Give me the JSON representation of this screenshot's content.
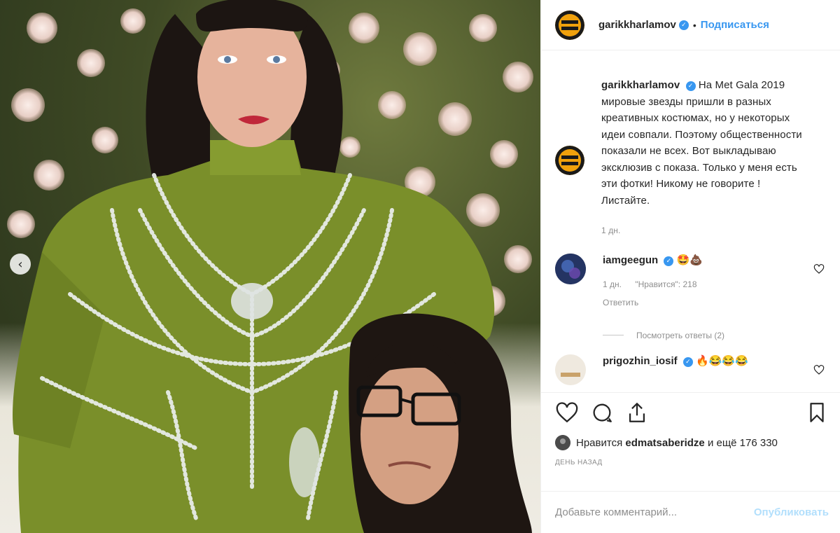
{
  "post": {
    "author": "garikkharlamov",
    "follow_label": "Подписаться",
    "separator": "•"
  },
  "caption": {
    "username": "garikkharlamov",
    "text": "На Met Gala 2019 мировые звезды пришли в разных креативных костюмах, но у некоторых идеи совпали. Поэтому общественности показали не всех. Вот выкладываю эксклюзив с показа. Только у меня есть эти фотки! Никому не говорите ! Листайте.",
    "time": "1 дн."
  },
  "comments": [
    {
      "username": "iamgeegun",
      "text": "🤩💩",
      "time": "1 дн.",
      "likes": "\"Нравится\": 218",
      "reply_label": "Ответить"
    },
    {
      "username": "prigozhin_iosif",
      "text": "🔥😂😂😂",
      "time": "",
      "likes": "",
      "reply_label": ""
    }
  ],
  "view_replies": "Посмотреть ответы (2)",
  "likes": {
    "prefix": "Нравится",
    "user": "edmatsaberidze",
    "suffix": "и ещё 176 330"
  },
  "timestamp": "День назад",
  "comment_input": {
    "placeholder": "Добавьте комментарий...",
    "publish_label": "Опубликовать"
  },
  "icons": {
    "verified": "verified-badge-icon",
    "like": "heart-icon",
    "comment": "comment-bubble-icon",
    "share": "share-icon",
    "save": "bookmark-icon",
    "prev": "chevron-left-icon"
  },
  "colors": {
    "accent": "#3897f0",
    "publish_disabled": "#b2dffc",
    "muted": "#8e8e8e",
    "dress": "#7a8f2a"
  }
}
